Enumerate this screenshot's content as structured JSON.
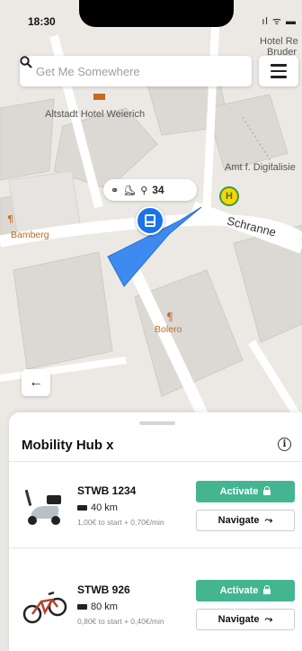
{
  "status_bar": {
    "time": "18:30",
    "icons": "ıl ᯤ ▬"
  },
  "search": {
    "placeholder": "Get Me Somewhere"
  },
  "map": {
    "labels": {
      "hotel_top": "Hotel Re",
      "hotel_top_2": "Bruder",
      "altstadt_hotel": "Altstadt Hotel Weierich",
      "amt": "Amt f. Digitalisie",
      "bamberg": "Bamberg",
      "street": "Schranne",
      "bolero": "Bolero"
    },
    "vehicle_count": "34",
    "bus_stop_letter": "H"
  },
  "sheet": {
    "title": "Mobility Hub x",
    "vehicles": [
      {
        "name": "STWB 1234",
        "range": "40 km",
        "price": "1,00€ to start + 0,70€/min",
        "activate_label": "Activate",
        "navigate_label": "Navigate",
        "type": "scooter-icon"
      },
      {
        "name": "STWB 926",
        "range": "80 km",
        "price": "0,80€ to start + 0,40€/min",
        "activate_label": "Activate",
        "navigate_label": "Navigate",
        "type": "bicycle-icon"
      }
    ]
  },
  "colors": {
    "accent_green": "#43b691",
    "hub_blue": "#1a73e8",
    "zone_blue": "#3d8bf0",
    "bus_yellow": "#ffd400"
  }
}
